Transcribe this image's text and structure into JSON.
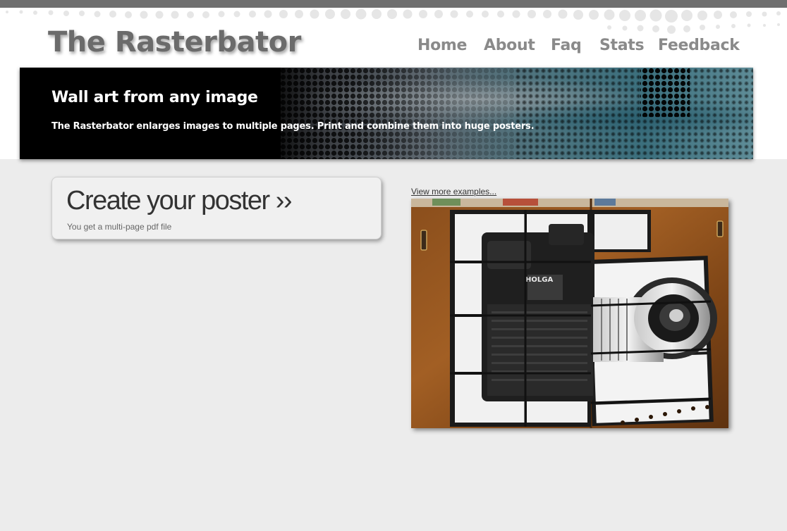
{
  "site": {
    "logo": "The Rasterbator"
  },
  "nav": {
    "items": [
      {
        "label": "Home"
      },
      {
        "label": "About"
      },
      {
        "label": "Faq"
      },
      {
        "label": "Stats"
      },
      {
        "label": "Feedback"
      }
    ]
  },
  "banner": {
    "title": "Wall art from any image",
    "subtitle": "The Rasterbator enlarges images to multiple pages. Print and combine them into huge posters."
  },
  "cta": {
    "title": "Create your poster ››",
    "subtitle": "You get a multi-page pdf file"
  },
  "examples": {
    "link_label": "View more examples..."
  },
  "colors": {
    "top_bar": "#6f6f6f",
    "page_background": "#ececec",
    "logo": "#6b6b6b",
    "nav": "#8a8a8a"
  }
}
